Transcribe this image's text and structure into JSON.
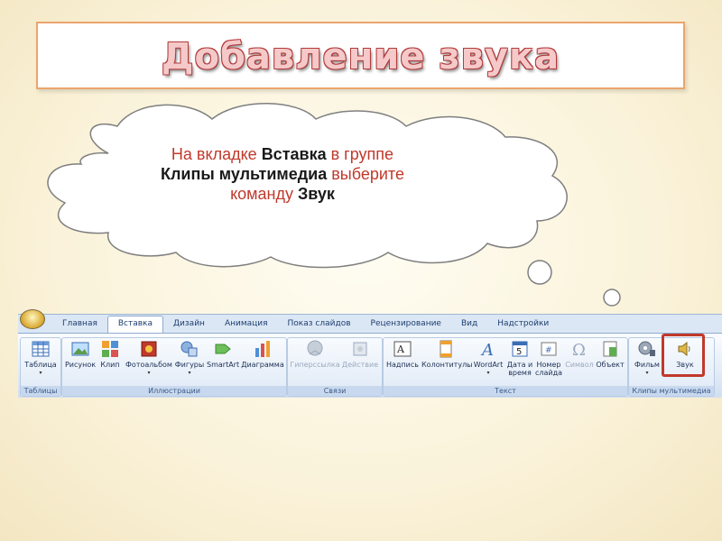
{
  "title": "Добавление звука",
  "bubble": {
    "prefix": "На вкладке ",
    "tab_name": "Вставка",
    "middle1": " в группе",
    "group_name": "Клипы мультимедиа",
    "middle2": " выберите",
    "line3_prefix": "команду ",
    "command_name": "Звук"
  },
  "ribbon": {
    "tabs": [
      "Главная",
      "Вставка",
      "Дизайн",
      "Анимация",
      "Показ слайдов",
      "Рецензирование",
      "Вид",
      "Надстройки"
    ],
    "active_tab": "Вставка",
    "groups": {
      "tables": {
        "label": "Таблицы",
        "buttons": {
          "table": "Таблица"
        }
      },
      "illustrations": {
        "label": "Иллюстрации",
        "buttons": {
          "picture": "Рисунок",
          "clip": "Клип",
          "album": "Фотоальбом",
          "shapes": "Фигуры",
          "smartart": "SmartArt",
          "chart": "Диаграмма"
        }
      },
      "links": {
        "label": "Связи",
        "buttons": {
          "hyperlink": "Гиперссылка",
          "action": "Действие"
        }
      },
      "text": {
        "label": "Текст",
        "buttons": {
          "textbox": "Надпись",
          "headerfooter": "Колонтитулы",
          "wordart": "WordArt",
          "datetime_1": "Дата и",
          "datetime_2": "время",
          "slidenum_1": "Номер",
          "slidenum_2": "слайда",
          "symbol": "Символ",
          "object": "Объект"
        }
      },
      "media": {
        "label": "Клипы мультимедиа",
        "buttons": {
          "movie": "Фильм",
          "sound": "Звук"
        }
      }
    }
  },
  "colors": {
    "accent_red": "#c0392b",
    "title_border": "#eaa56d"
  }
}
